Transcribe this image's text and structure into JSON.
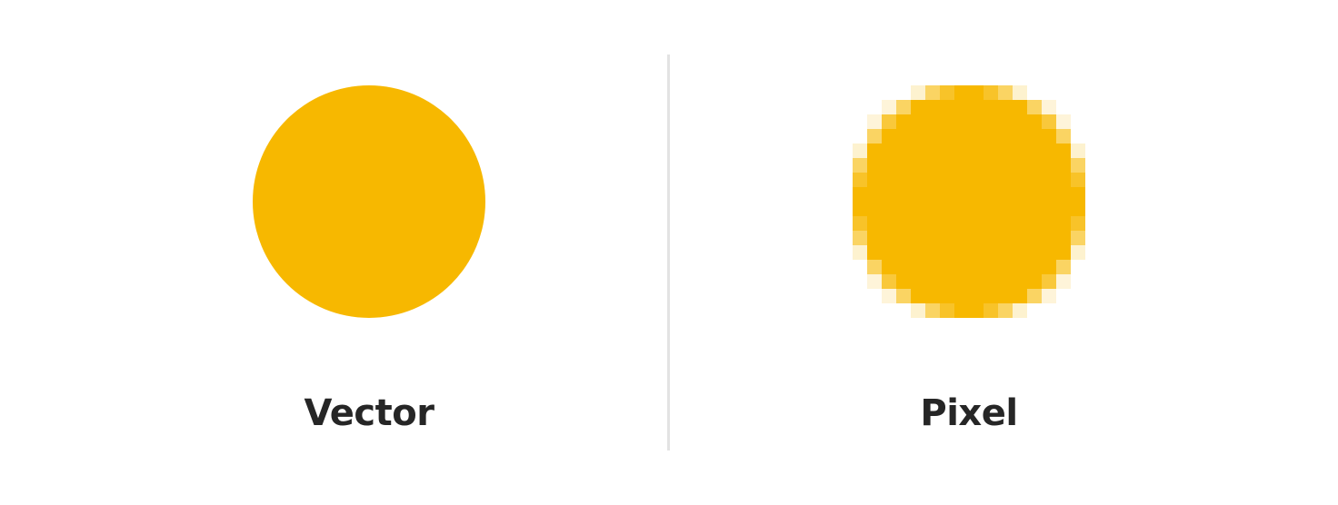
{
  "colors": {
    "fill": "#F7B800",
    "divider": "#E3E3E3",
    "text": "#262626",
    "background": "#FFFFFF"
  },
  "left_panel": {
    "label": "Vector",
    "shape": "circle"
  },
  "right_panel": {
    "label": "Pixel",
    "shape": "pixelated-circle",
    "grid_cells": 16
  }
}
